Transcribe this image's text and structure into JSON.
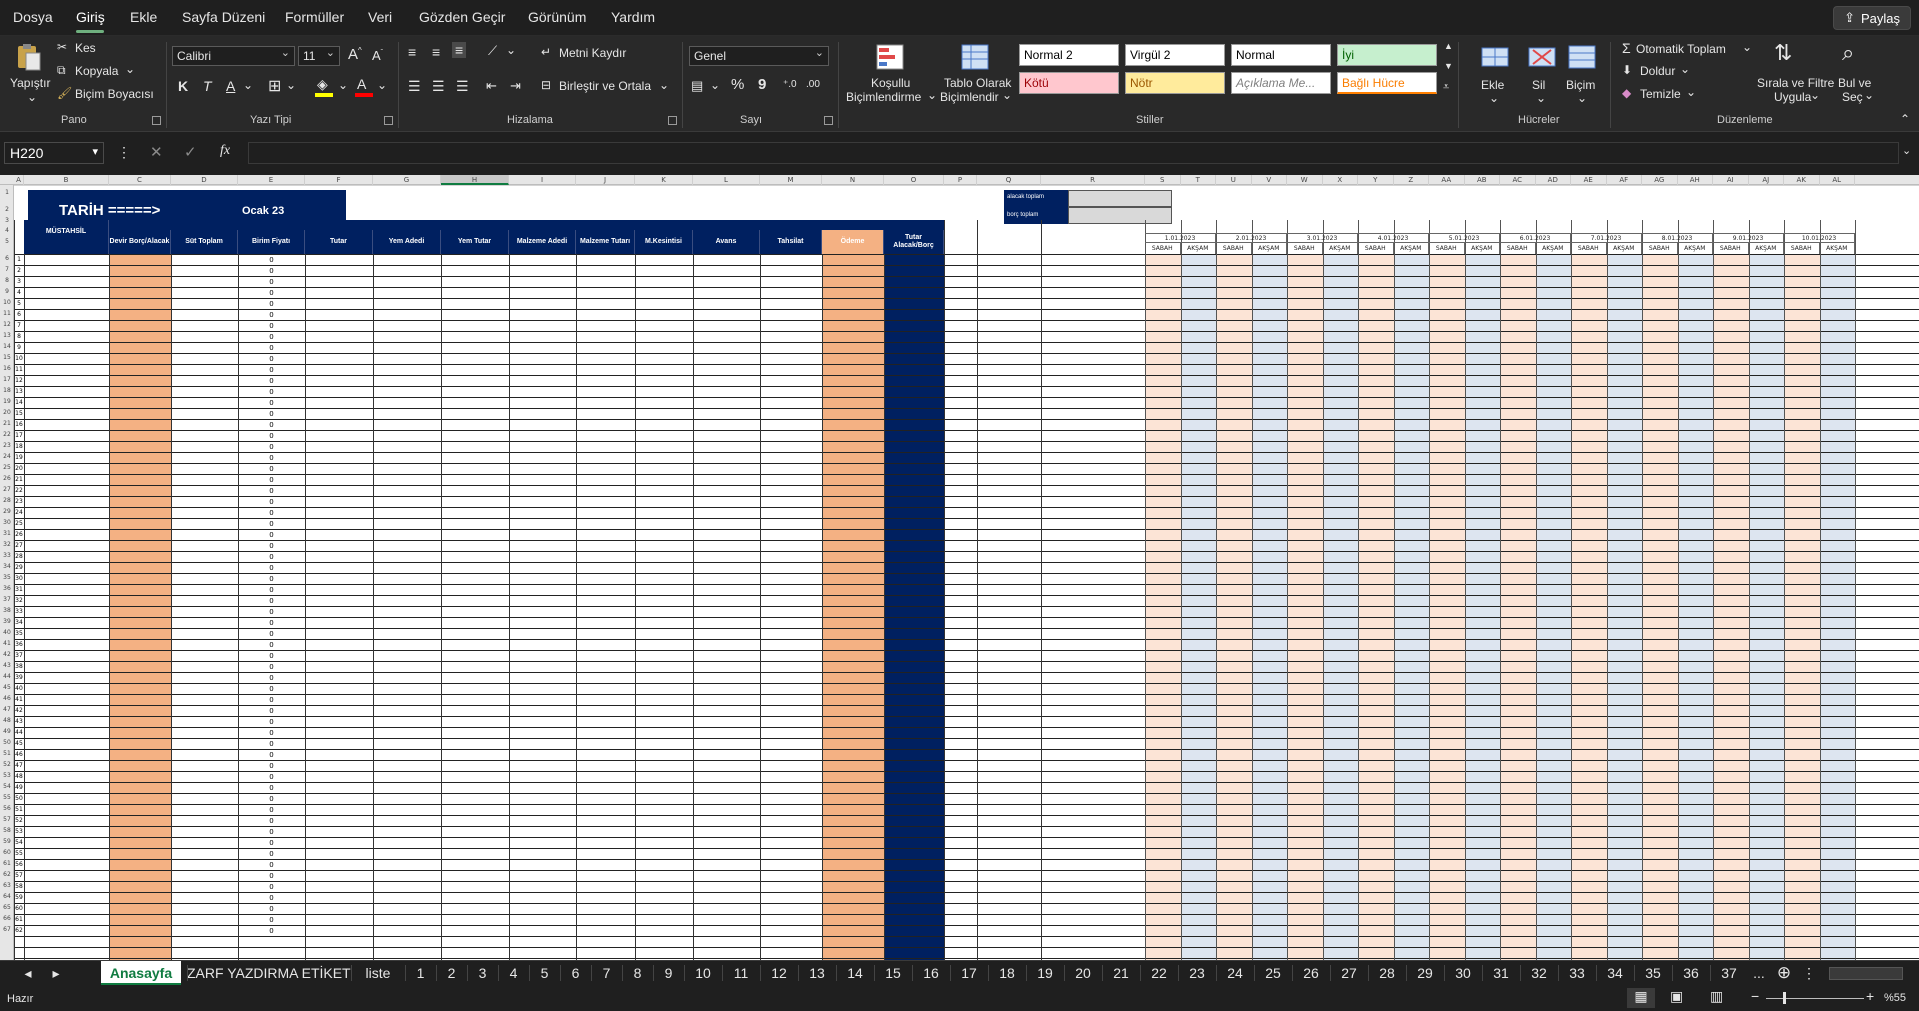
{
  "menu": {
    "items": [
      "Dosya",
      "Giriş",
      "Ekle",
      "Sayfa Düzeni",
      "Formüller",
      "Veri",
      "Gözden Geçir",
      "Görünüm",
      "Yardım"
    ],
    "share": "Paylaş"
  },
  "ribbon": {
    "clipboard": {
      "paste": "Yapıştır",
      "cut": "Kes",
      "copy": "Kopyala",
      "format_painter": "Biçim Boyacısı",
      "label": "Pano"
    },
    "font": {
      "name": "Calibri",
      "size": "11",
      "bold": "K",
      "italic": "T",
      "underline": "A",
      "color_a": "A",
      "label": "Yazı Tipi"
    },
    "alignment": {
      "wrap": "Metni Kaydır",
      "merge": "Birleştir ve Ortala",
      "label": "Hizalama"
    },
    "number": {
      "format": "Genel",
      "percent": "%",
      "comma": "9",
      "label": "Sayı"
    },
    "styles": {
      "cond_fmt_1": "Koşullu",
      "cond_fmt_2": "Biçimlendirme",
      "table_fmt_1": "Tablo Olarak",
      "table_fmt_2": "Biçimlendir",
      "cells": [
        "Normal 2",
        "Virgül 2",
        "Normal",
        "İyi",
        "Kötü",
        "Nötr",
        "Açıklama Me...",
        "Bağlı Hücre"
      ],
      "label": "Stiller"
    },
    "cells": {
      "insert": "Ekle",
      "delete": "Sil",
      "format": "Biçim",
      "label": "Hücreler"
    },
    "editing": {
      "autosum": "Otomatik Toplam",
      "fill": "Doldur",
      "clear": "Temizle",
      "sort_1": "Sırala ve Filtre",
      "sort_2": "Uygula",
      "find_1": "Bul ve",
      "find_2": "Seç",
      "label": "Düzenleme"
    }
  },
  "formula_bar": {
    "name_box": "H220",
    "fx": "fx",
    "value": ""
  },
  "sheet": {
    "columns": [
      "A",
      "B",
      "C",
      "D",
      "E",
      "F",
      "G",
      "H",
      "I",
      "J",
      "K",
      "L",
      "M",
      "N",
      "O",
      "P",
      "Q",
      "R",
      "S",
      "T",
      "U",
      "V",
      "W",
      "X",
      "Y",
      "Z",
      "AA",
      "AB",
      "AC",
      "AD",
      "AE",
      "AF",
      "AG",
      "AH",
      "AI",
      "AJ",
      "AK",
      "AL"
    ],
    "title": "TARİH =====>",
    "month": "Ocak 23",
    "summary": {
      "credit": "alacak toplam",
      "debt": "borç toplam"
    },
    "headers": [
      "MÜSTAHSİL",
      "Devir Borç/Alacak",
      "Süt Toplam",
      "Birim Fiyatı",
      "Tutar",
      "Yem Adedi",
      "Yem Tutar",
      "Malzeme Adedi",
      "Malzeme Tutarı",
      "M.Kesintisi",
      "Avans",
      "Tahsilat",
      "Ödeme",
      "Tutar Alacak/Borç"
    ],
    "dates": [
      "1.01.2023",
      "2.01.2023",
      "3.01.2023",
      "4.01.2023",
      "5.01.2023",
      "6.01.2023",
      "7.01.2023",
      "8.01.2023",
      "9.01.2023",
      "10.01.2023"
    ],
    "shift_morning": "SABAH",
    "shift_evening": "AKŞAM",
    "zero_value": "0",
    "row_numbers": [
      "1",
      "2",
      "3",
      "4",
      "5",
      "6",
      "7",
      "8",
      "9",
      "10",
      "11",
      "12",
      "13",
      "14",
      "15",
      "16",
      "17",
      "18",
      "19",
      "20",
      "21",
      "22",
      "23",
      "24",
      "25",
      "26",
      "27",
      "28",
      "29",
      "30",
      "31",
      "32",
      "33",
      "34",
      "35",
      "36",
      "37",
      "38",
      "39",
      "40",
      "41",
      "42",
      "43",
      "44",
      "45",
      "46",
      "47",
      "48",
      "49",
      "50",
      "51",
      "52",
      "53",
      "54",
      "55",
      "56",
      "57",
      "58",
      "59",
      "60",
      "61",
      "62",
      "63",
      "64",
      "65",
      "66",
      "67"
    ],
    "index_numbers": [
      "1",
      "2",
      "3",
      "4",
      "5",
      "6",
      "7",
      "8",
      "9",
      "10",
      "11",
      "12",
      "13",
      "14",
      "15",
      "16",
      "17",
      "18",
      "19",
      "20",
      "21",
      "22",
      "23",
      "24",
      "25",
      "26",
      "27",
      "28",
      "29",
      "30",
      "31",
      "32",
      "33",
      "34",
      "35",
      "36",
      "37",
      "38",
      "39",
      "40",
      "41",
      "42",
      "43",
      "44",
      "45",
      "46",
      "47",
      "48",
      "49",
      "50",
      "51",
      "52",
      "53",
      "54",
      "55",
      "56",
      "57",
      "58",
      "59",
      "60",
      "61",
      "62"
    ]
  },
  "tabs": {
    "names": [
      "Anasayfa",
      "ZARF YAZDIRMA ETİKET",
      "liste",
      "1",
      "2",
      "3",
      "4",
      "5",
      "6",
      "7",
      "8",
      "9",
      "10",
      "11",
      "12",
      "13",
      "14",
      "15",
      "16",
      "17",
      "18",
      "19",
      "20",
      "21",
      "22",
      "23",
      "24",
      "25",
      "26",
      "27",
      "28",
      "29",
      "30",
      "31",
      "32",
      "33",
      "34",
      "35",
      "36",
      "37"
    ],
    "more": "..."
  },
  "status": {
    "ready": "Hazır",
    "zoom": "%55"
  },
  "colors": {
    "navy": "#002060",
    "peach": "#f4b183",
    "light_peach": "#fce4d6",
    "light_blue": "#dde5f0",
    "excel_green": "#107c41"
  }
}
